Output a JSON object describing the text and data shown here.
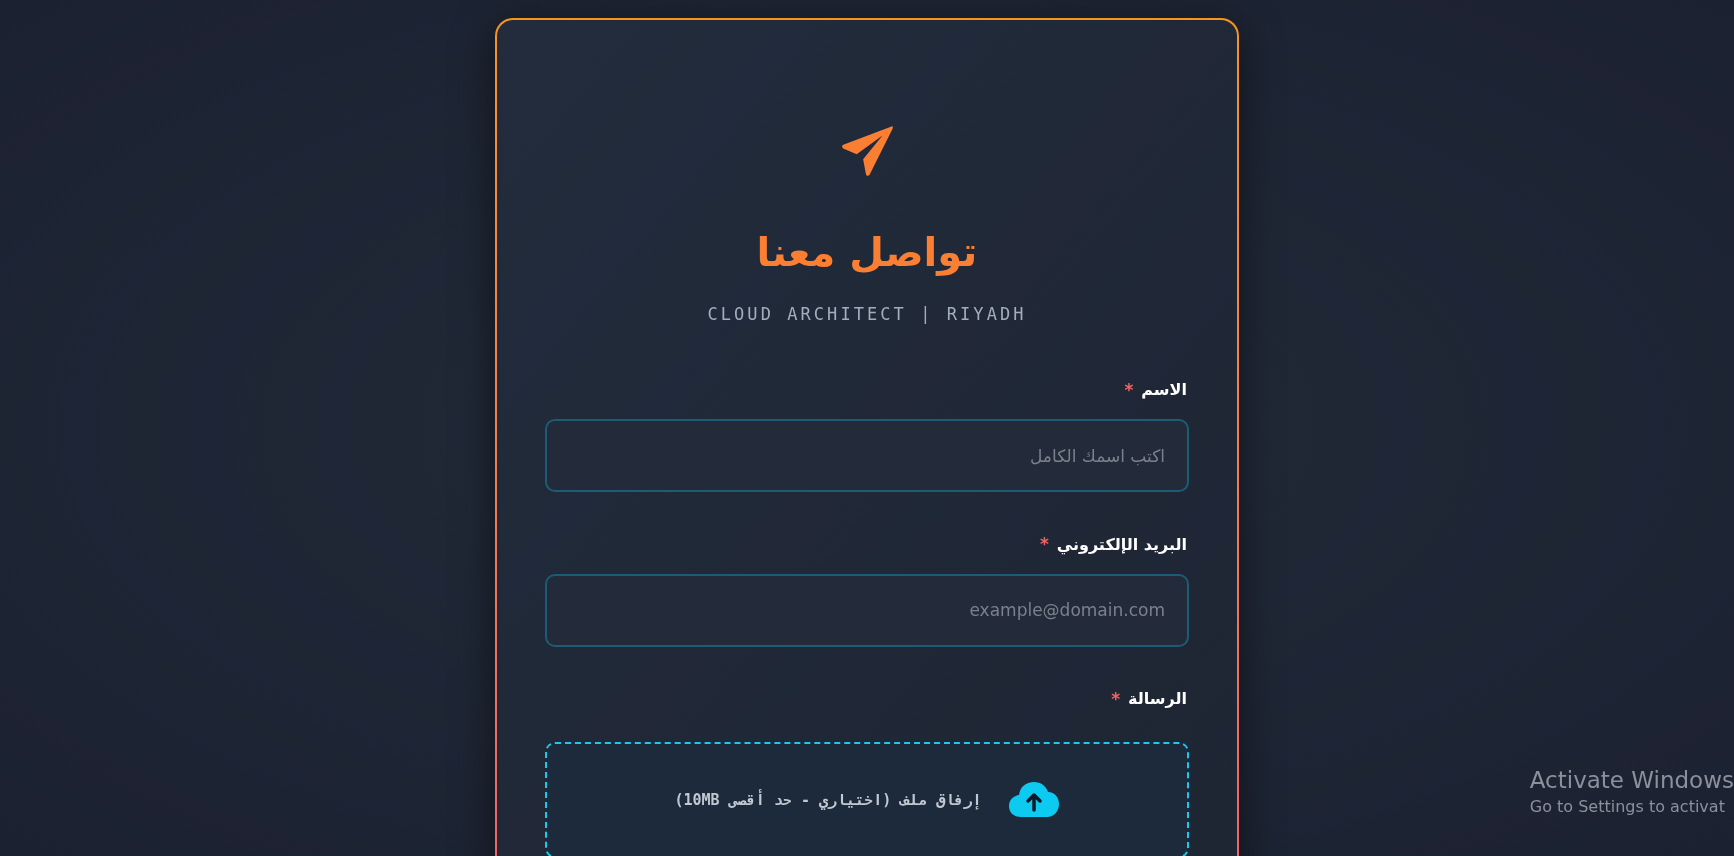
{
  "header": {
    "title": "تواصل معنا",
    "subtitle": "CLOUD ARCHITECT | RIYADH"
  },
  "fields": [
    {
      "kind": "text",
      "label": "الاسم",
      "required_mark": "*",
      "placeholder": "اكتب اسمك الكامل"
    },
    {
      "kind": "email",
      "label": "البريد الإلكتروني",
      "required_mark": "*",
      "placeholder": "example@domain.com"
    },
    {
      "kind": "message",
      "label": "الرسالة",
      "required_mark": "*"
    }
  ],
  "upload": {
    "label": "إرفاق ملف (اختياري - حد أقصى 10MB)"
  },
  "os_notice": {
    "title": "Activate Windows",
    "text": "Go to Settings to activat"
  }
}
